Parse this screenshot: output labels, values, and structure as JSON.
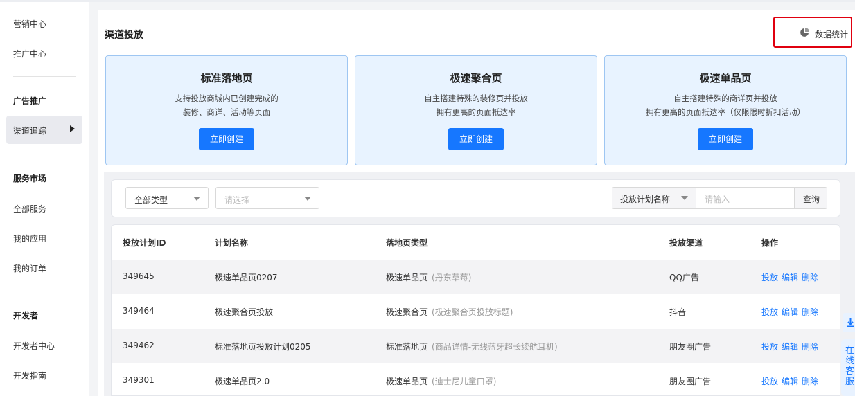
{
  "sidebar": {
    "items": [
      {
        "label": "营销中心"
      },
      {
        "label": "推广中心"
      }
    ],
    "groups": {
      "ad": "广告推广",
      "services": "服务市场",
      "developer": "开发者"
    },
    "active": "渠道追踪",
    "service_items": [
      "全部服务",
      "我的应用",
      "我的订单"
    ],
    "dev_items": [
      "开发者中心",
      "开发指南"
    ]
  },
  "page": {
    "title": "渠道投放",
    "stats_label": "数据统计"
  },
  "cards": [
    {
      "title": "标准落地页",
      "line1": "支持投放商城内已创建完成的",
      "line2": "装修、商详、活动等页面",
      "button": "立即创建"
    },
    {
      "title": "极速聚合页",
      "line1": "自主搭建特殊的装修页并投放",
      "line2": "拥有更高的页面抵达率",
      "button": "立即创建"
    },
    {
      "title": "极速单品页",
      "line1": "自主搭建特殊的商详页并投放",
      "line2": "拥有更高的页面抵达率（仅限限时折扣活动）",
      "button": "立即创建"
    }
  ],
  "filters": {
    "type_value": "全部类型",
    "second_placeholder": "请选择",
    "search_field": "投放计划名称",
    "search_placeholder": "请输入",
    "search_button": "查询"
  },
  "table": {
    "headers": [
      "投放计划ID",
      "计划名称",
      "落地页类型",
      "投放渠道",
      "操作"
    ],
    "actions": [
      "投放",
      "编辑",
      "删除"
    ],
    "rows": [
      {
        "id": "349645",
        "name": "极速单品页0207",
        "type": "极速单品页",
        "type_sub": "(丹东草莓)",
        "channel": "QQ广告"
      },
      {
        "id": "349464",
        "name": "极速聚合页投放",
        "type": "极速聚合页",
        "type_sub": "(极速聚合页投放标题)",
        "channel": "抖音"
      },
      {
        "id": "349462",
        "name": "标准落地页投放计划0205",
        "type": "标准落地页",
        "type_sub": "(商品详情-无线蓝牙超长续航耳机)",
        "channel": "朋友圈广告"
      },
      {
        "id": "349301",
        "name": "极速单品页2.0",
        "type": "极速单品页",
        "type_sub": "(迪士尼儿童口罩)",
        "channel": "朋友圈广告"
      }
    ]
  },
  "float": {
    "chat_label": "在线客服"
  },
  "colors": {
    "accent": "#1677ff",
    "highlight_border": "#e0000f",
    "card_bg": "#e8f3ff"
  }
}
